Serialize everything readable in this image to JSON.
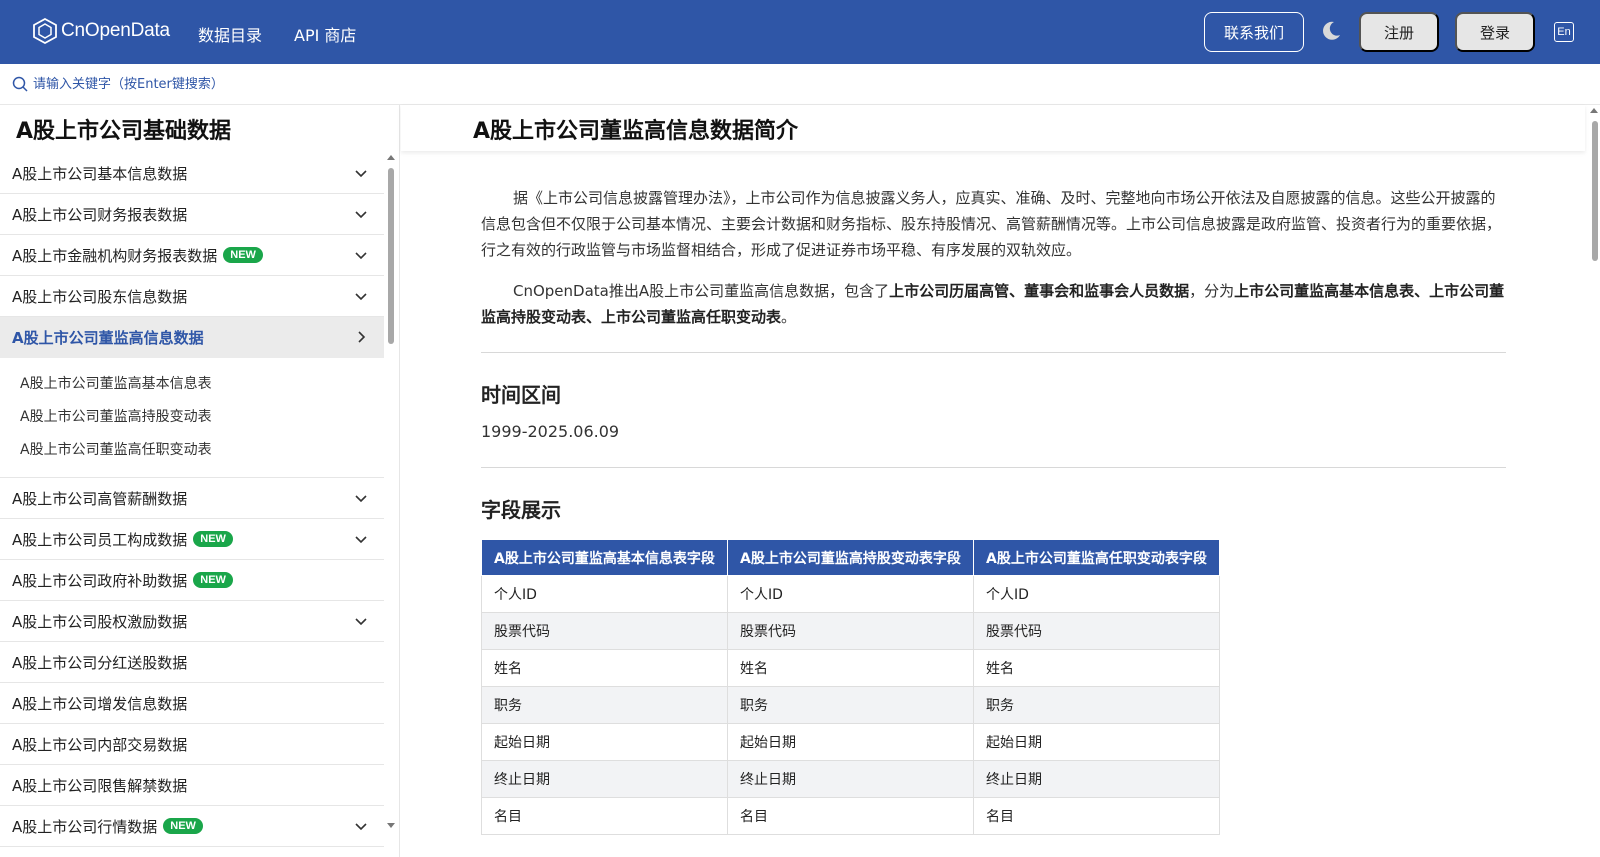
{
  "header": {
    "logo_text": "CnOpenData",
    "nav": [
      "数据目录",
      "API 商店"
    ],
    "contact_label": "联系我们",
    "register_label": "注册",
    "login_label": "登录",
    "lang_label": "En",
    "color_bg": "#2f56a7"
  },
  "search": {
    "placeholder": "请输入关键字（按Enter键搜索）"
  },
  "sidebar": {
    "title": "A股上市公司基础数据",
    "items_before": [
      {
        "label": "A股上市公司基本信息数据",
        "badge": "",
        "chevron": "down"
      },
      {
        "label": "A股上市公司财务报表数据",
        "badge": "",
        "chevron": "down"
      },
      {
        "label": "A股上市金融机构财务报表数据",
        "badge": "NEW",
        "chevron": "down"
      },
      {
        "label": "A股上市公司股东信息数据",
        "badge": "",
        "chevron": "down"
      }
    ],
    "active_item": {
      "label": "A股上市公司董监高信息数据",
      "chevron": "right"
    },
    "sub_items": [
      "A股上市公司董监高基本信息表",
      "A股上市公司董监高持股变动表",
      "A股上市公司董监高任职变动表"
    ],
    "items_after": [
      {
        "label": "A股上市公司高管薪酬数据",
        "badge": "",
        "chevron": "down"
      },
      {
        "label": "A股上市公司员工构成数据",
        "badge": "NEW",
        "chevron": "down"
      },
      {
        "label": "A股上市公司政府补助数据",
        "badge": "NEW",
        "chevron": ""
      },
      {
        "label": "A股上市公司股权激励数据",
        "badge": "",
        "chevron": "down"
      },
      {
        "label": "A股上市公司分红送股数据",
        "badge": "",
        "chevron": ""
      },
      {
        "label": "A股上市公司增发信息数据",
        "badge": "",
        "chevron": ""
      },
      {
        "label": "A股上市公司内部交易数据",
        "badge": "",
        "chevron": ""
      },
      {
        "label": "A股上市公司限售解禁数据",
        "badge": "",
        "chevron": ""
      },
      {
        "label": "A股上市公司行情数据",
        "badge": "NEW",
        "chevron": "down"
      }
    ]
  },
  "main": {
    "title": "A股上市公司董监高信息数据简介",
    "para1": "据《上市公司信息披露管理办法》，上市公司作为信息披露义务人，应真实、准确、及时、完整地向市场公开依法及自愿披露的信息。这些公开披露的信息包含但不仅限于公司基本情况、主要会计数据和财务指标、股东持股情况、高管薪酬情况等。上市公司信息披露是政府监管、投资者行为的重要依据，行之有效的行政监管与市场监督相结合，形成了促进证券市场平稳、有序发展的双轨效应。",
    "para2_a": "CnOpenData推出A股上市公司董监高信息数据，包含了",
    "para2_b": "上市公司历届高管、董事会和监事会人员数据",
    "para2_c": "，分为",
    "para2_d": "上市公司董监高基本信息表、上市公司董监高持股变动表、上市公司董监高任职变动表",
    "para2_e": "。",
    "time_title": "时间区间",
    "time_value": "1999-2025.06.09",
    "fields_title": "字段展示",
    "table_headers": [
      "A股上市公司董监高基本信息表字段",
      "A股上市公司董监高持股变动表字段",
      "A股上市公司董监高任职变动表字段"
    ],
    "table_rows": [
      [
        "个人ID",
        "个人ID",
        "个人ID"
      ],
      [
        "股票代码",
        "股票代码",
        "股票代码"
      ],
      [
        "姓名",
        "姓名",
        "姓名"
      ],
      [
        "职务",
        "职务",
        "职务"
      ],
      [
        "起始日期",
        "起始日期",
        "起始日期"
      ],
      [
        "终止日期",
        "终止日期",
        "终止日期"
      ],
      [
        "名目",
        "名目",
        "名目"
      ]
    ]
  }
}
